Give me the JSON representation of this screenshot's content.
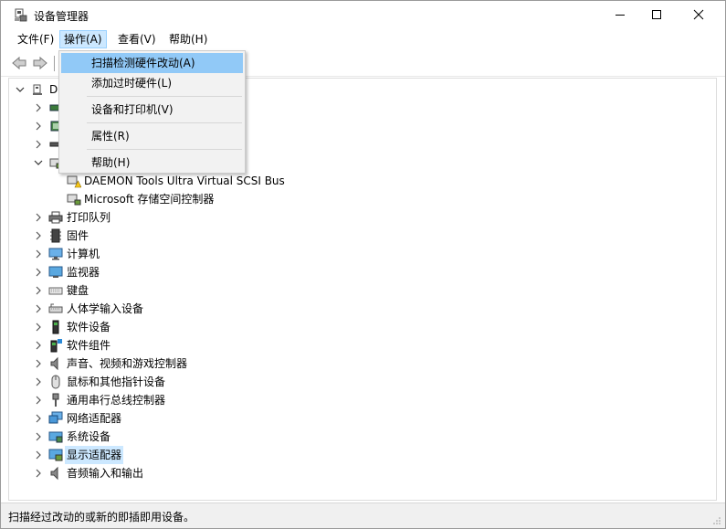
{
  "window": {
    "title": "设备管理器"
  },
  "menubar": [
    {
      "label": "文件(F)"
    },
    {
      "label": "操作(A)"
    },
    {
      "label": "查看(V)"
    },
    {
      "label": "帮助(H)"
    }
  ],
  "dropdown": {
    "items": [
      {
        "label": "扫描检测硬件改动(A)"
      },
      {
        "label": "添加过时硬件(L)"
      },
      {
        "label": "设备和打印机(V)"
      },
      {
        "label": "属性(R)"
      },
      {
        "label": "帮助(H)"
      }
    ]
  },
  "tree": {
    "root_label": "D",
    "children": [
      {
        "label": "DAEMON Tools Ultra Virtual SCSI Bus"
      },
      {
        "label": "Microsoft 存储空间控制器"
      }
    ],
    "items": [
      {
        "label": "打印队列"
      },
      {
        "label": "固件"
      },
      {
        "label": "计算机"
      },
      {
        "label": "监视器"
      },
      {
        "label": "键盘"
      },
      {
        "label": "人体学输入设备"
      },
      {
        "label": "软件设备"
      },
      {
        "label": "软件组件"
      },
      {
        "label": "声音、视频和游戏控制器"
      },
      {
        "label": "鼠标和其他指针设备"
      },
      {
        "label": "通用串行总线控制器"
      },
      {
        "label": "网络适配器"
      },
      {
        "label": "系统设备"
      },
      {
        "label": "显示适配器"
      },
      {
        "label": "音频输入和输出"
      }
    ]
  },
  "statusbar": {
    "text": "扫描经过改动的或新的即插即用设备。"
  },
  "colors": {
    "menu_highlight": "#91c9f7",
    "selection": "#cce8ff",
    "active_menu": "#cce8ff"
  }
}
